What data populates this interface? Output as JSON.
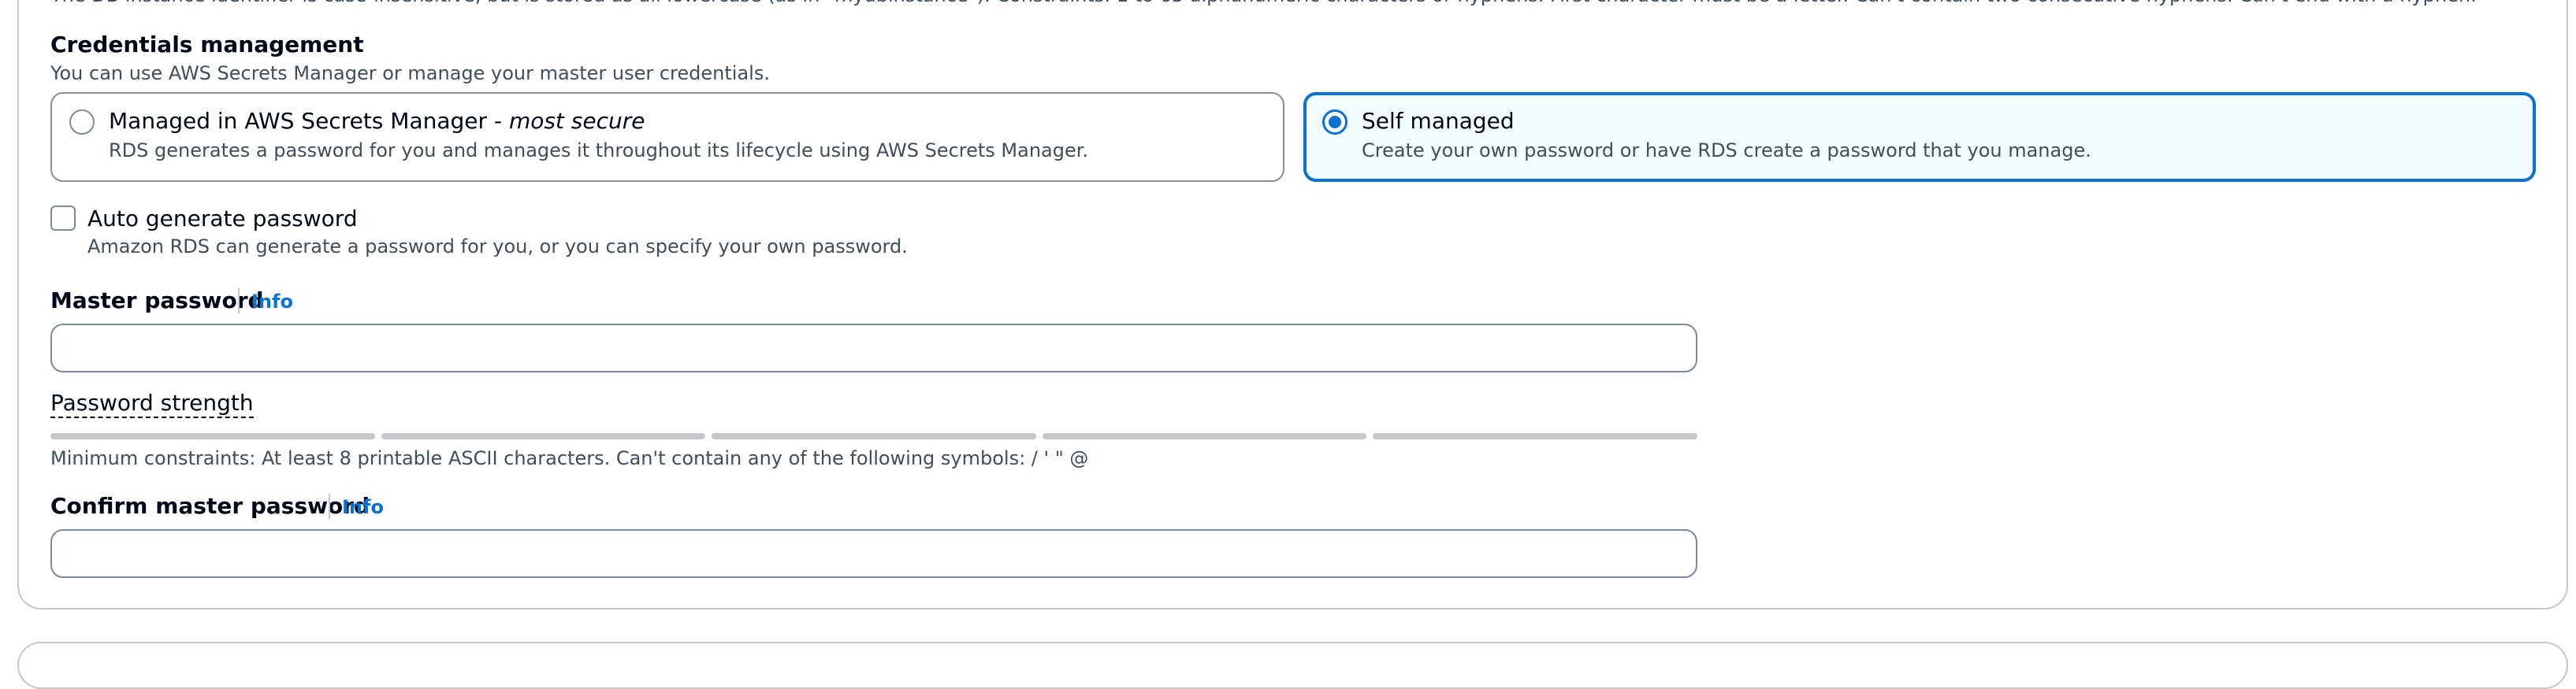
{
  "top_clipped_text": "The DB instance identifier is case-insensitive, but is stored as all lowercase (as in \"mydbinstance\"). Constraints: 1 to 63 alphanumeric characters or hyphens. First character must be a letter. Can't contain two consecutive hyphens. Can't end with a hyphen.",
  "credentials": {
    "title": "Credentials management",
    "description": "You can use AWS Secrets Manager or manage your master user credentials.",
    "options": [
      {
        "label": "Managed in AWS Secrets Manager - ",
        "label_emphasis": "most secure",
        "description": "RDS generates a password for you and manages it throughout its lifecycle using AWS Secrets Manager.",
        "selected": false
      },
      {
        "label": "Self managed",
        "description": "Create your own password or have RDS create a password that you manage.",
        "selected": true
      }
    ]
  },
  "auto_generate": {
    "label": "Auto generate password",
    "description": "Amazon RDS can generate a password for you, or you can specify your own password.",
    "checked": false
  },
  "master_password": {
    "label": "Master password",
    "info": "Info",
    "value": ""
  },
  "password_strength": {
    "label": "Password strength",
    "segments": 5,
    "filled": 0
  },
  "constraints": "Minimum constraints: At least 8 printable ASCII characters. Can't contain any of the following symbols: / ' \" @",
  "confirm_password": {
    "label": "Confirm master password",
    "info": "Info",
    "value": ""
  },
  "colors": {
    "accent": "#0972d3",
    "selected_tile_bg": "#f2fbff",
    "border": "#7d8998",
    "muted_text": "#414d5c"
  }
}
